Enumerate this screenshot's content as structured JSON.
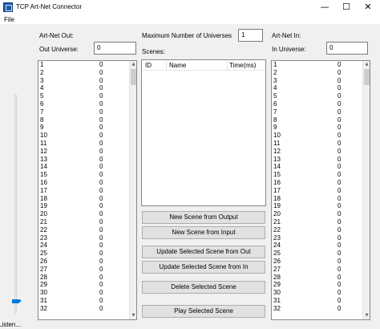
{
  "window": {
    "title": "TCP Art-Net Connector",
    "minimize_glyph": "—",
    "maximize_glyph": "☐",
    "close_glyph": "✕"
  },
  "menu": {
    "file": "File"
  },
  "out": {
    "heading": "Art-Net Out:",
    "universe_label": "Out Universe:",
    "universe_value": "0"
  },
  "center": {
    "max_universes_label": "Maximum Number of Universes",
    "max_universes_value": "1",
    "scenes_label": "Scenes:",
    "columns": [
      "ID",
      "Name",
      "Time(ms)"
    ]
  },
  "in": {
    "heading": "Art-Net In:",
    "universe_label": "In Universe:",
    "universe_value": "0"
  },
  "buttons": {
    "new_from_output": "New Scene from Output",
    "new_from_input": "New Scene from Input",
    "update_from_out": "Update Selected Scene from Out",
    "update_from_in": "Update Selected Scene from In",
    "delete": "Delete Selected Scene",
    "play": "Play Selected Scene"
  },
  "channels_out": [
    {
      "ch": "1",
      "val": "0"
    },
    {
      "ch": "2",
      "val": "0"
    },
    {
      "ch": "3",
      "val": "0"
    },
    {
      "ch": "4",
      "val": "0"
    },
    {
      "ch": "5",
      "val": "0"
    },
    {
      "ch": "6",
      "val": "0"
    },
    {
      "ch": "7",
      "val": "0"
    },
    {
      "ch": "8",
      "val": "0"
    },
    {
      "ch": "9",
      "val": "0"
    },
    {
      "ch": "10",
      "val": "0"
    },
    {
      "ch": "11",
      "val": "0"
    },
    {
      "ch": "12",
      "val": "0"
    },
    {
      "ch": "13",
      "val": "0"
    },
    {
      "ch": "14",
      "val": "0"
    },
    {
      "ch": "15",
      "val": "0"
    },
    {
      "ch": "16",
      "val": "0"
    },
    {
      "ch": "17",
      "val": "0"
    },
    {
      "ch": "18",
      "val": "0"
    },
    {
      "ch": "19",
      "val": "0"
    },
    {
      "ch": "20",
      "val": "0"
    },
    {
      "ch": "21",
      "val": "0"
    },
    {
      "ch": "22",
      "val": "0"
    },
    {
      "ch": "23",
      "val": "0"
    },
    {
      "ch": "24",
      "val": "0"
    },
    {
      "ch": "25",
      "val": "0"
    },
    {
      "ch": "26",
      "val": "0"
    },
    {
      "ch": "27",
      "val": "0"
    },
    {
      "ch": "28",
      "val": "0"
    },
    {
      "ch": "29",
      "val": "0"
    },
    {
      "ch": "30",
      "val": "0"
    },
    {
      "ch": "31",
      "val": "0"
    },
    {
      "ch": "32",
      "val": "0"
    }
  ],
  "channels_in": [
    {
      "ch": "1",
      "val": "0"
    },
    {
      "ch": "2",
      "val": "0"
    },
    {
      "ch": "3",
      "val": "0"
    },
    {
      "ch": "4",
      "val": "0"
    },
    {
      "ch": "5",
      "val": "0"
    },
    {
      "ch": "6",
      "val": "0"
    },
    {
      "ch": "7",
      "val": "0"
    },
    {
      "ch": "8",
      "val": "0"
    },
    {
      "ch": "9",
      "val": "0"
    },
    {
      "ch": "10",
      "val": "0"
    },
    {
      "ch": "11",
      "val": "0"
    },
    {
      "ch": "12",
      "val": "0"
    },
    {
      "ch": "13",
      "val": "0"
    },
    {
      "ch": "14",
      "val": "0"
    },
    {
      "ch": "15",
      "val": "0"
    },
    {
      "ch": "16",
      "val": "0"
    },
    {
      "ch": "17",
      "val": "0"
    },
    {
      "ch": "18",
      "val": "0"
    },
    {
      "ch": "19",
      "val": "0"
    },
    {
      "ch": "20",
      "val": "0"
    },
    {
      "ch": "21",
      "val": "0"
    },
    {
      "ch": "22",
      "val": "0"
    },
    {
      "ch": "23",
      "val": "0"
    },
    {
      "ch": "24",
      "val": "0"
    },
    {
      "ch": "25",
      "val": "0"
    },
    {
      "ch": "26",
      "val": "0"
    },
    {
      "ch": "27",
      "val": "0"
    },
    {
      "ch": "28",
      "val": "0"
    },
    {
      "ch": "29",
      "val": "0"
    },
    {
      "ch": "30",
      "val": "0"
    },
    {
      "ch": "31",
      "val": "0"
    },
    {
      "ch": "32",
      "val": "0"
    }
  ],
  "slider_level": 0,
  "status_text": "Listen..."
}
